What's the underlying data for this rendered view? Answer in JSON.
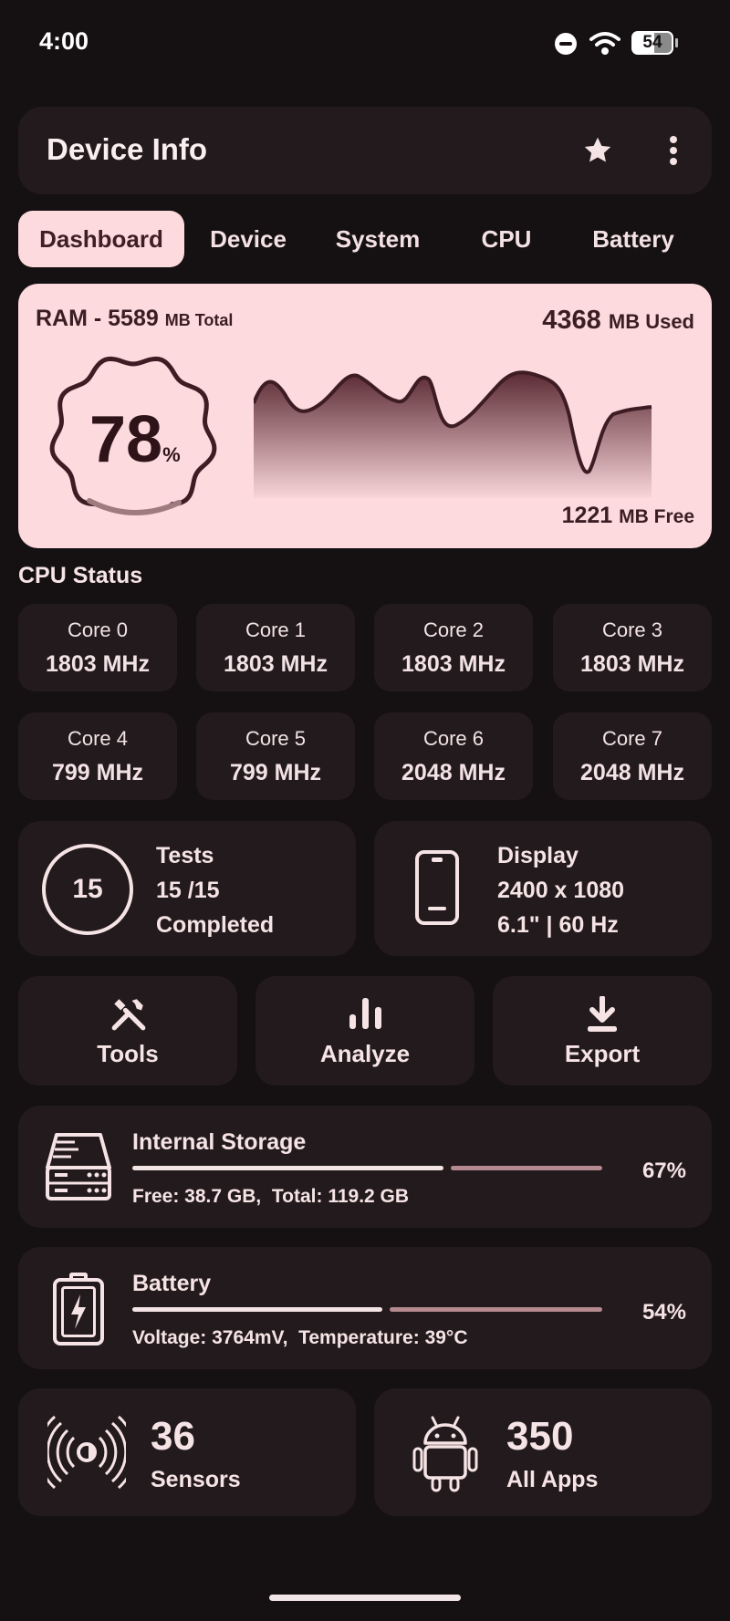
{
  "status_bar": {
    "time": "4:00",
    "battery_level": "54"
  },
  "app": {
    "title": "Device Info"
  },
  "tabs": [
    {
      "label": "Dashboard",
      "active": true
    },
    {
      "label": "Device"
    },
    {
      "label": "System"
    },
    {
      "label": "CPU"
    },
    {
      "label": "Battery"
    }
  ],
  "ram": {
    "label": "RAM - ",
    "total_value": "5589",
    "total_unit": "MB Total",
    "used_value": "4368",
    "used_unit": "MB Used",
    "percent": "78",
    "percent_sign": "%",
    "free_value": "1221",
    "free_unit": "MB Free"
  },
  "cpu": {
    "title": "CPU Status",
    "cores": [
      {
        "name": "Core 0",
        "freq": "1803 MHz"
      },
      {
        "name": "Core 1",
        "freq": "1803 MHz"
      },
      {
        "name": "Core 2",
        "freq": "1803 MHz"
      },
      {
        "name": "Core 3",
        "freq": "1803 MHz"
      },
      {
        "name": "Core 4",
        "freq": "799 MHz"
      },
      {
        "name": "Core 5",
        "freq": "799 MHz"
      },
      {
        "name": "Core 6",
        "freq": "2048 MHz"
      },
      {
        "name": "Core 7",
        "freq": "2048 MHz"
      }
    ]
  },
  "tests": {
    "count": "15",
    "title": "Tests",
    "progress": "15 /15",
    "status": "Completed"
  },
  "display": {
    "title": "Display",
    "resolution": "2400 x 1080",
    "spec": "6.1\" | 60 Hz"
  },
  "actions": {
    "tools": "Tools",
    "analyze": "Analyze",
    "export": "Export"
  },
  "storage": {
    "title": "Internal Storage",
    "detail": "Free: 38.7 GB,  Total: 119.2 GB",
    "percent": "67%",
    "used_fraction": 0.67
  },
  "battery": {
    "title": "Battery",
    "detail": "Voltage: 3764mV,  Temperature: 39°C",
    "percent": "54%",
    "level_fraction": 0.54
  },
  "sensors": {
    "count": "36",
    "label": "Sensors"
  },
  "apps": {
    "count": "350",
    "label": "All Apps"
  },
  "colors": {
    "accent": "#fddadd",
    "card": "#221a1c",
    "background": "#151011",
    "bar_muted": "#b48a90"
  }
}
